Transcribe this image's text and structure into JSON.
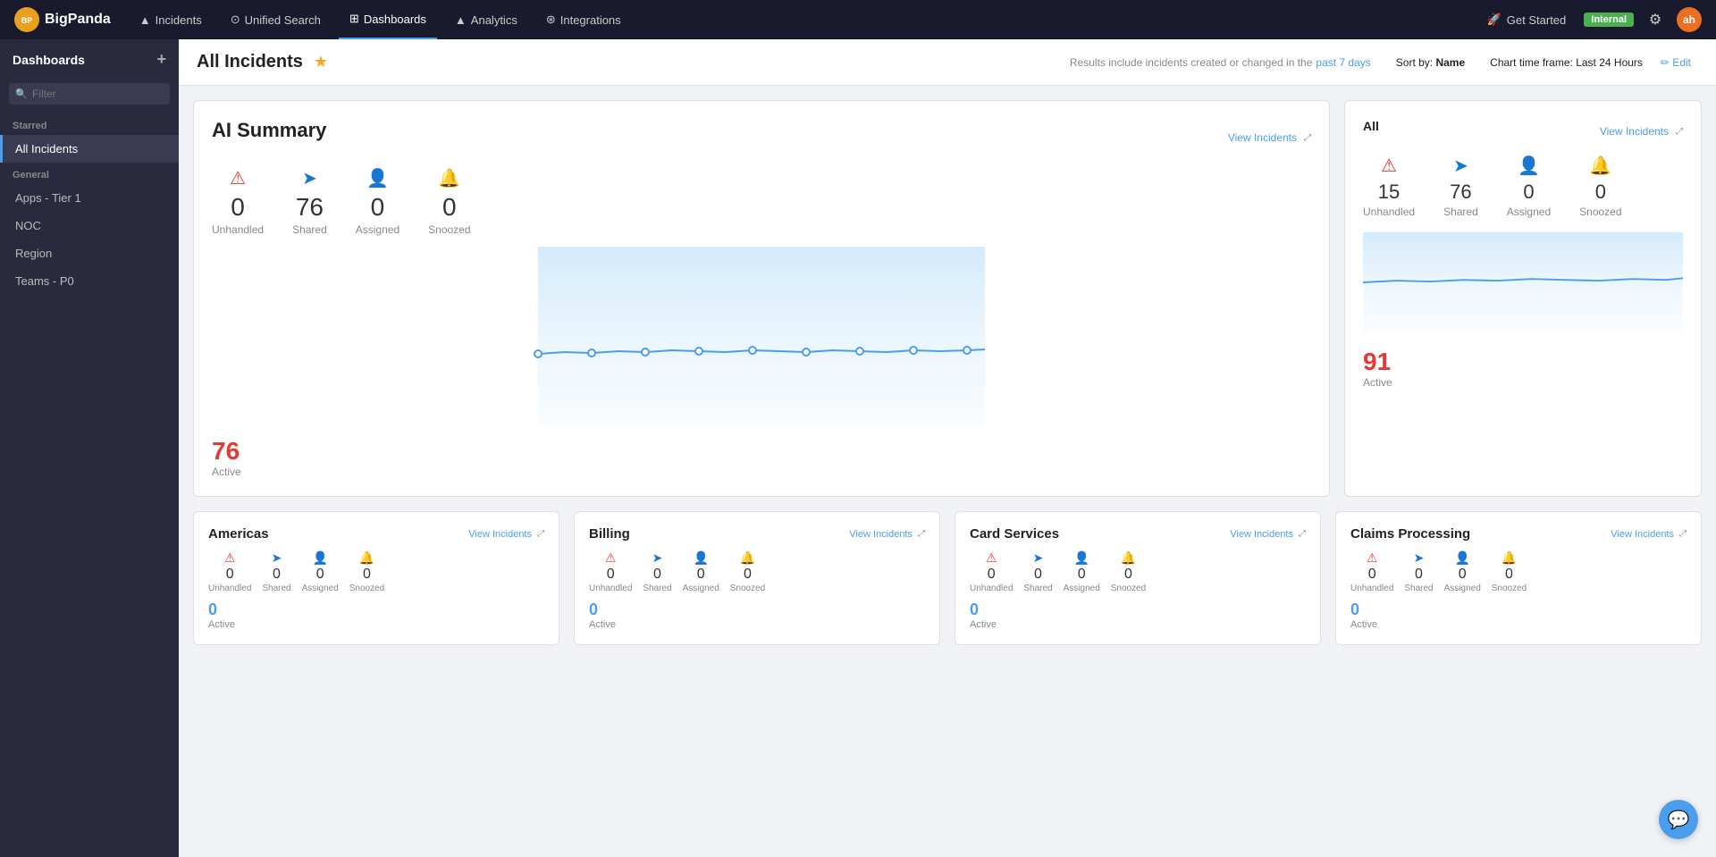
{
  "app": {
    "name": "BigPanda",
    "logo_text": "BP"
  },
  "topnav": {
    "items": [
      {
        "id": "incidents",
        "label": "Incidents",
        "icon": "▲",
        "active": false
      },
      {
        "id": "unified-search",
        "label": "Unified Search",
        "icon": "⊙",
        "active": false
      },
      {
        "id": "dashboards",
        "label": "Dashboards",
        "icon": "⊞",
        "active": true
      },
      {
        "id": "analytics",
        "label": "Analytics",
        "icon": "▲",
        "active": false
      },
      {
        "id": "integrations",
        "label": "Integrations",
        "icon": "⊛",
        "active": false
      }
    ],
    "get_started": "Get Started",
    "badge": "Internal",
    "avatar": "ah"
  },
  "sidebar": {
    "title": "Dashboards",
    "add_label": "+",
    "filter_placeholder": "Filter",
    "starred_label": "Starred",
    "general_label": "General",
    "items_starred": [
      {
        "id": "all-incidents",
        "label": "All Incidents",
        "active": true
      }
    ],
    "items_general": [
      {
        "id": "apps-tier-1",
        "label": "Apps - Tier 1",
        "active": false
      },
      {
        "id": "noc",
        "label": "NOC",
        "active": false
      },
      {
        "id": "region",
        "label": "Region",
        "active": false
      },
      {
        "id": "teams-p0",
        "label": "Teams - P0",
        "active": false
      }
    ]
  },
  "page": {
    "title": "All Incidents",
    "results_text": "Results include incidents created or changed in the",
    "time_range": "past 7 days",
    "sort_by_label": "Sort by:",
    "sort_by_value": "Name",
    "chart_timeframe_label": "Chart time frame:",
    "chart_timeframe_value": "Last 24 Hours",
    "edit_label": "✏ Edit"
  },
  "ai_summary": {
    "title": "AI Summary",
    "view_incidents_label": "View Incidents",
    "stats": {
      "unhandled": {
        "value": "0",
        "label": "Unhandled"
      },
      "shared": {
        "value": "76",
        "label": "Shared"
      },
      "assigned": {
        "value": "0",
        "label": "Assigned"
      },
      "snoozed": {
        "value": "0",
        "label": "Snoozed"
      }
    },
    "active": {
      "value": "76",
      "label": "Active"
    }
  },
  "all_panel": {
    "title": "All",
    "view_incidents_label": "View Incidents",
    "stats": {
      "unhandled": {
        "value": "15",
        "label": "Unhandled"
      },
      "shared": {
        "value": "76",
        "label": "Shared"
      },
      "assigned": {
        "value": "0",
        "label": "Assigned"
      },
      "snoozed": {
        "value": "0",
        "label": "Snoozed"
      }
    },
    "active": {
      "value": "91",
      "label": "Active"
    }
  },
  "bottom_cards": [
    {
      "id": "americas",
      "title": "Americas",
      "view_incidents_label": "View Incidents",
      "stats": {
        "unhandled": {
          "value": "0",
          "label": "Unhandled"
        },
        "shared": {
          "value": "0",
          "label": "Shared"
        },
        "assigned": {
          "value": "0",
          "label": "Assigned"
        },
        "snoozed": {
          "value": "0",
          "label": "Snoozed"
        }
      },
      "active": {
        "value": "0",
        "label": "Active"
      }
    },
    {
      "id": "billing",
      "title": "Billing",
      "view_incidents_label": "View Incidents",
      "stats": {
        "unhandled": {
          "value": "0",
          "label": "Unhandled"
        },
        "shared": {
          "value": "0",
          "label": "Shared"
        },
        "assigned": {
          "value": "0",
          "label": "Assigned"
        },
        "snoozed": {
          "value": "0",
          "label": "Snoozed"
        }
      },
      "active": {
        "value": "0",
        "label": "Active"
      }
    },
    {
      "id": "card-services",
      "title": "Card Services",
      "view_incidents_label": "View Incidents",
      "stats": {
        "unhandled": {
          "value": "0",
          "label": "Unhandled"
        },
        "shared": {
          "value": "0",
          "label": "Shared"
        },
        "assigned": {
          "value": "0",
          "label": "Assigned"
        },
        "snoozed": {
          "value": "0",
          "label": "Snoozed"
        }
      },
      "active": {
        "value": "0",
        "label": "Active"
      }
    },
    {
      "id": "claims-processing",
      "title": "Claims Processing",
      "view_incidents_label": "View Incidents",
      "stats": {
        "unhandled": {
          "value": "0",
          "label": "Unhandled"
        },
        "shared": {
          "value": "0",
          "label": "Shared"
        },
        "assigned": {
          "value": "0",
          "label": "Assigned"
        },
        "snoozed": {
          "value": "0",
          "label": "Snoozed"
        }
      },
      "active": {
        "value": "0",
        "label": "Active"
      }
    }
  ],
  "colors": {
    "accent_blue": "#4a9eed",
    "accent_red": "#e53935",
    "warning_red": "#e53935",
    "share_blue": "#1976d2",
    "person_orange": "#f59c00",
    "bell_gray": "#555555"
  }
}
